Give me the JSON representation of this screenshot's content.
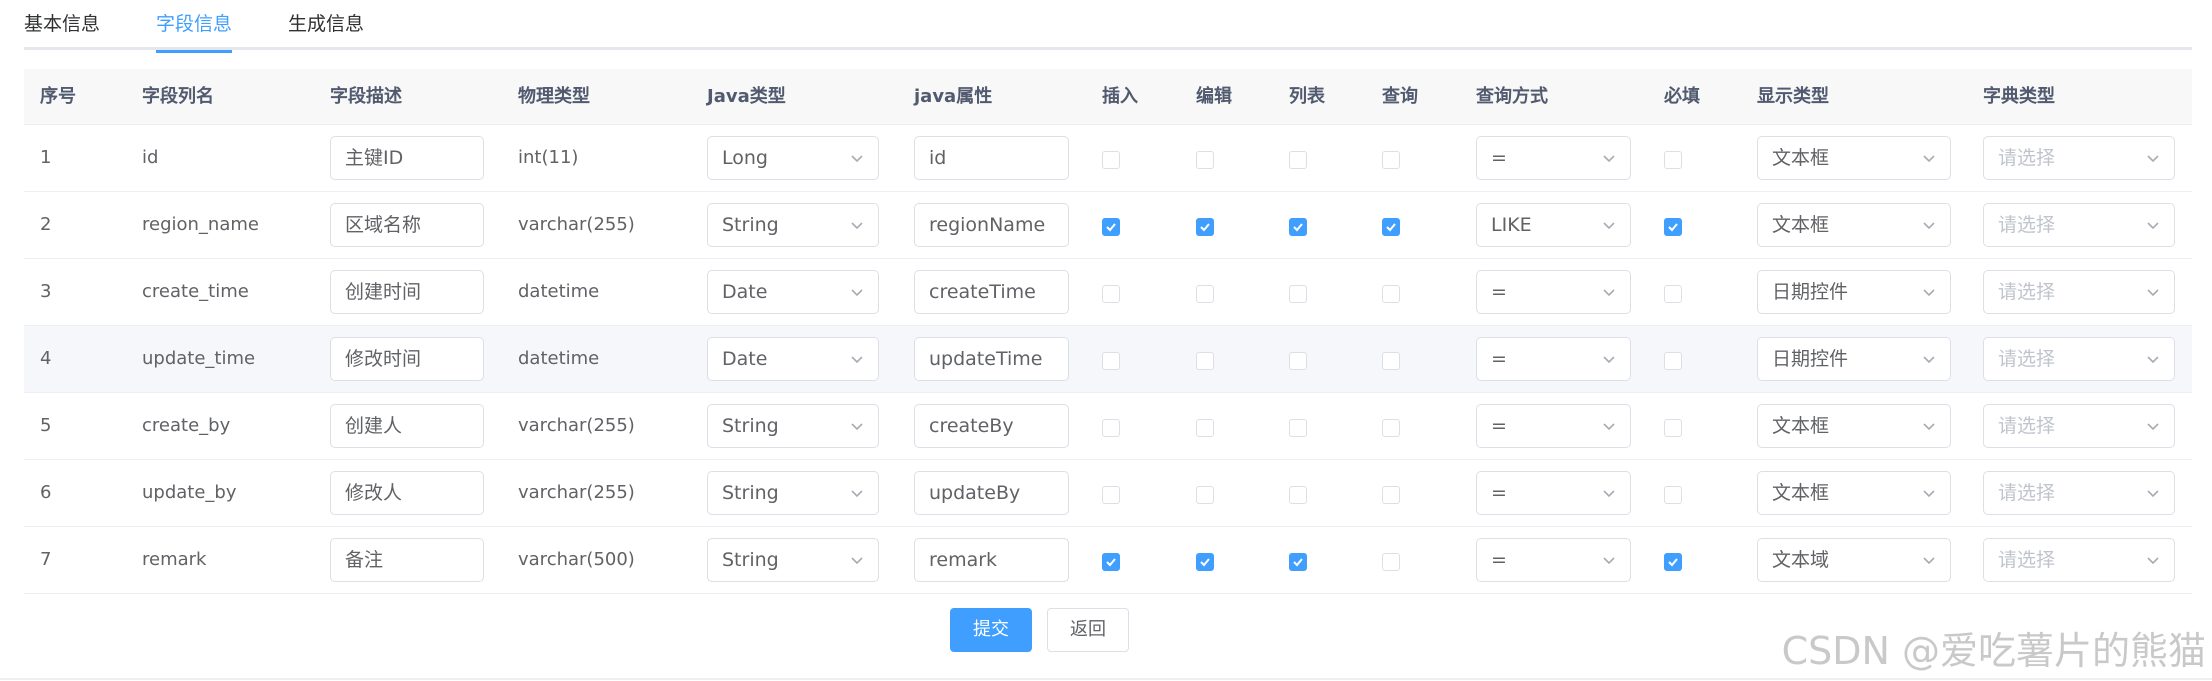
{
  "tabs": [
    "基本信息",
    "字段信息",
    "生成信息"
  ],
  "active_tab": 1,
  "columns": [
    "序号",
    "字段列名",
    "字段描述",
    "物理类型",
    "Java类型",
    "java属性",
    "插入",
    "编辑",
    "列表",
    "查询",
    "查询方式",
    "必填",
    "显示类型",
    "字典类型"
  ],
  "dict_placeholder": "请选择",
  "rows": [
    {
      "no": "1",
      "name": "id",
      "desc": "主键ID",
      "phys": "int(11)",
      "jtype": "Long",
      "jprop": "id",
      "insert": false,
      "edit": false,
      "list": false,
      "query": false,
      "qmode": "=",
      "required": false,
      "display": "文本框"
    },
    {
      "no": "2",
      "name": "region_name",
      "desc": "区域名称",
      "phys": "varchar(255)",
      "jtype": "String",
      "jprop": "regionName",
      "insert": true,
      "edit": true,
      "list": true,
      "query": true,
      "qmode": "LIKE",
      "required": true,
      "display": "文本框"
    },
    {
      "no": "3",
      "name": "create_time",
      "desc": "创建时间",
      "phys": "datetime",
      "jtype": "Date",
      "jprop": "createTime",
      "insert": false,
      "edit": false,
      "list": false,
      "query": false,
      "qmode": "=",
      "required": false,
      "display": "日期控件"
    },
    {
      "no": "4",
      "name": "update_time",
      "desc": "修改时间",
      "phys": "datetime",
      "jtype": "Date",
      "jprop": "updateTime",
      "insert": false,
      "edit": false,
      "list": false,
      "query": false,
      "qmode": "=",
      "required": false,
      "display": "日期控件"
    },
    {
      "no": "5",
      "name": "create_by",
      "desc": "创建人",
      "phys": "varchar(255)",
      "jtype": "String",
      "jprop": "createBy",
      "insert": false,
      "edit": false,
      "list": false,
      "query": false,
      "qmode": "=",
      "required": false,
      "display": "文本框"
    },
    {
      "no": "6",
      "name": "update_by",
      "desc": "修改人",
      "phys": "varchar(255)",
      "jtype": "String",
      "jprop": "updateBy",
      "insert": false,
      "edit": false,
      "list": false,
      "query": false,
      "qmode": "=",
      "required": false,
      "display": "文本框"
    },
    {
      "no": "7",
      "name": "remark",
      "desc": "备注",
      "phys": "varchar(500)",
      "jtype": "String",
      "jprop": "remark",
      "insert": true,
      "edit": true,
      "list": true,
      "query": false,
      "qmode": "=",
      "required": true,
      "display": "文本域"
    }
  ],
  "hover_row": 3,
  "buttons": {
    "submit": "提交",
    "back": "返回"
  },
  "watermark": "CSDN @爱吃薯片的熊猫",
  "colors": {
    "accent": "#409eff",
    "header_bg": "#f8f8f9",
    "border": "#dcdfe6"
  }
}
